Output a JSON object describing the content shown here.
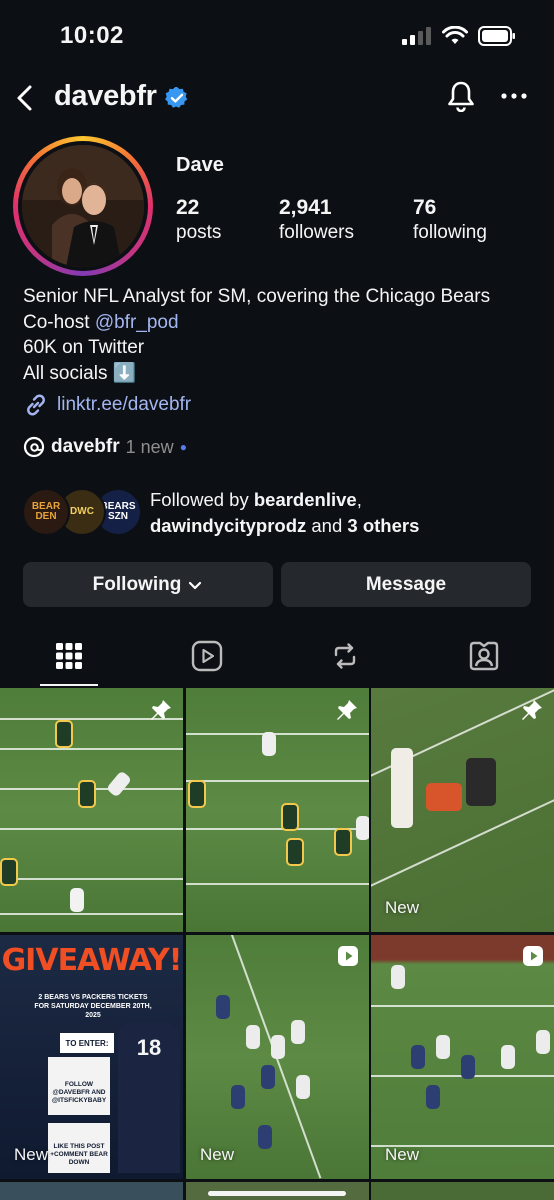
{
  "status_bar": {
    "time": "10:02"
  },
  "header": {
    "username": "davebfr"
  },
  "profile": {
    "display_name": "Dave",
    "stats": [
      {
        "value": "22",
        "label": "posts"
      },
      {
        "value": "2,941",
        "label": "followers"
      },
      {
        "value": "76",
        "label": "following"
      }
    ],
    "bio": {
      "line1": "Senior NFL Analyst for SM, covering the Chicago Bears",
      "line2_prefix": "Co-host ",
      "line2_mention": "@bfr_pod",
      "line3": "60K on Twitter",
      "line4": "All socials ⬇️"
    },
    "link": "linktr.ee/davebfr",
    "threads": {
      "handle": "davebfr",
      "badge": "1 new"
    },
    "followed_by": {
      "prefix": "Followed by ",
      "user1": "beardenlive",
      "sep": ",",
      "user2": "dawindycityprodz",
      "middle": " and ",
      "others": "3 others"
    },
    "follower_avatars": [
      {
        "text": "BEAR DEN"
      },
      {
        "text": "DWC"
      },
      {
        "text": "BEARS SZN"
      }
    ]
  },
  "buttons": {
    "following": "Following",
    "message": "Message"
  },
  "tabs": [
    "grid-icon",
    "reels-icon",
    "reposts-icon",
    "tagged-icon"
  ],
  "posts": [
    {
      "pinned": true,
      "new_label": ""
    },
    {
      "pinned": true,
      "new_label": ""
    },
    {
      "pinned": true,
      "new_label": "New"
    },
    {
      "pinned": false,
      "new_label": "New"
    },
    {
      "pinned": false,
      "reel": true,
      "new_label": "New"
    },
    {
      "pinned": false,
      "reel": true,
      "new_label": "New"
    }
  ],
  "giveaway": {
    "title": "GIVEAWAY!",
    "subtitle": "2 BEARS VS PACKERS TICKETS FOR SATURDAY DECEMBER 20TH, 2025",
    "to_enter": "TO ENTER:",
    "step1": "FOLLOW @DAVEBFR AND @ITSFICKYBABY",
    "step2": "LIKE THIS POST +COMMENT BEAR DOWN",
    "jersey": "18"
  },
  "colors": {
    "background": "#0c1014",
    "accent_link": "#a4b5f0",
    "verified": "#3897f0",
    "button_bg": "#25292e"
  }
}
